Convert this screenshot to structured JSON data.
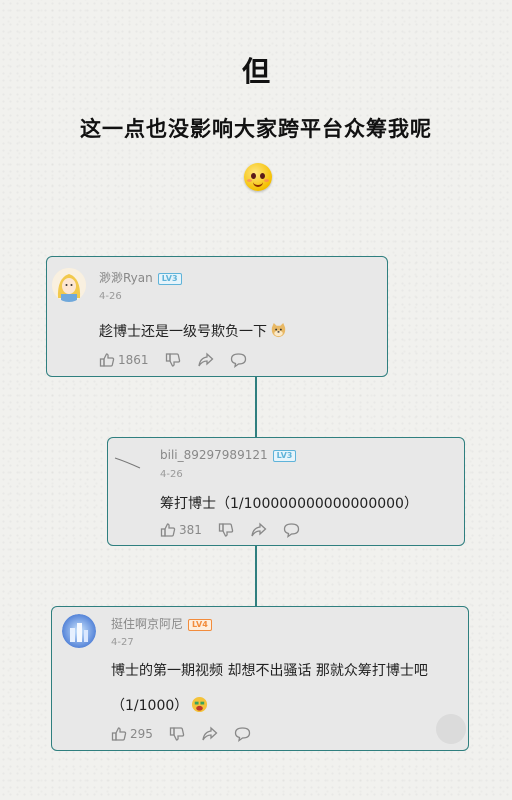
{
  "heading": {
    "line1": "但",
    "line2": "这一点也没影响大家跨平台众筹我呢"
  },
  "comments": [
    {
      "user": "渺渺Ryan",
      "level": "LV3",
      "date": "4-26",
      "text": "趁博士还是一级号欺负一下",
      "emoji": "doge-emoji",
      "likes": "1861"
    },
    {
      "user": "bili_89297989121",
      "level": "LV3",
      "date": "4-26",
      "text": "筹打博士（1/100000000000000000）",
      "likes": "381"
    },
    {
      "user": "挺住啊京阿尼",
      "level": "LV4",
      "date": "4-27",
      "text": "博士的第一期视频 却想不出骚话 那就众筹打博士吧",
      "text2": "（1/1000）",
      "emoji": "money-face-emoji",
      "likes": "295"
    }
  ],
  "colors": {
    "border": "#2f7f7f",
    "card": "#e8e8e8",
    "lv3": "#5fb3d9",
    "lv4": "#f28c3c"
  }
}
